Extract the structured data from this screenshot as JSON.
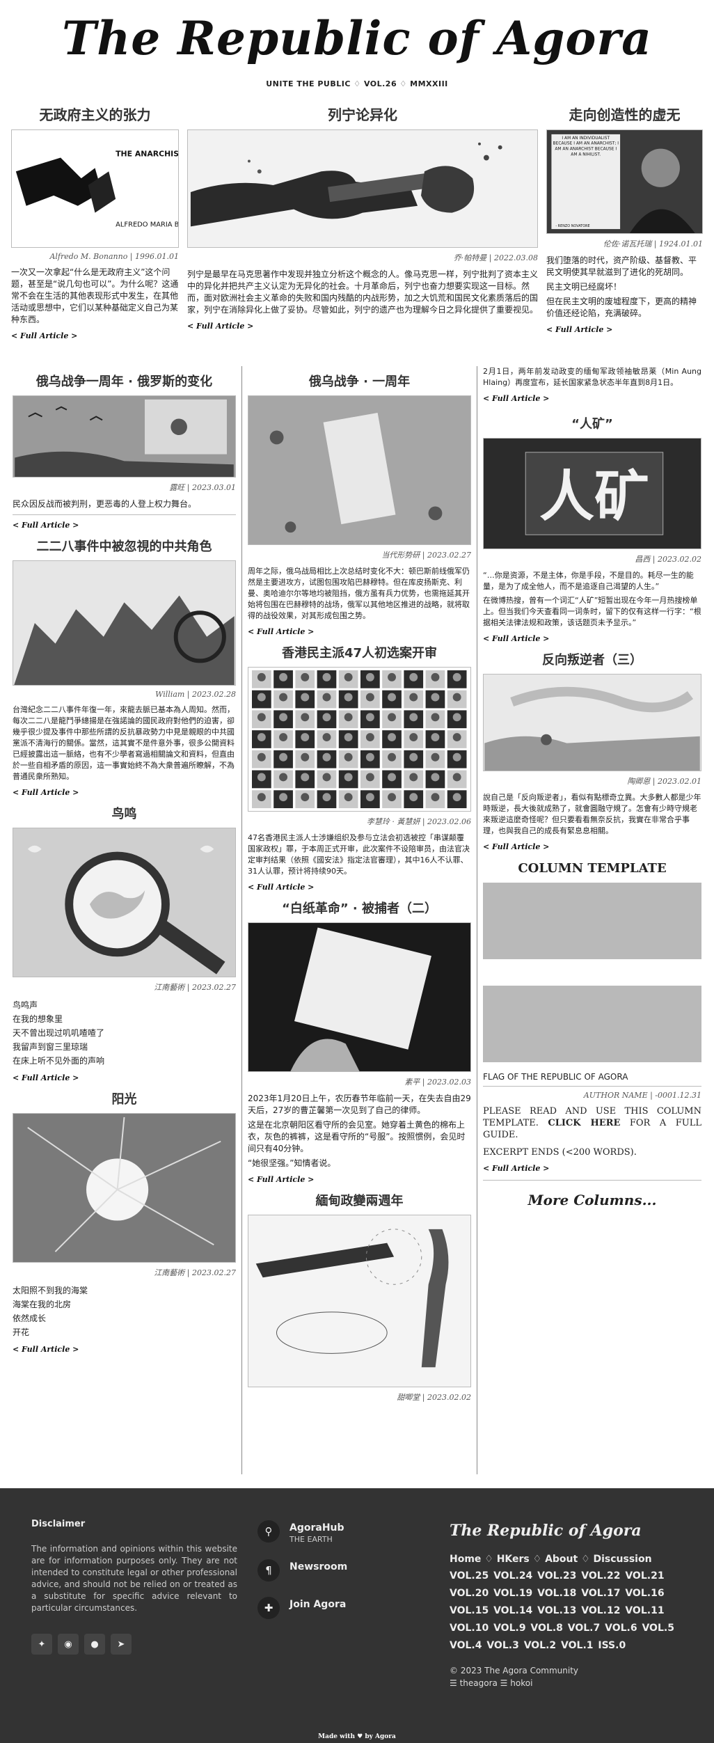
{
  "masthead": {
    "title": "The Republic of Agora",
    "subtitle": "UNITE THE PUBLIC ♢ VOL.26 ♢ MMXXIII"
  },
  "common": {
    "full_article": "< Full Article >"
  },
  "top": [
    {
      "title": "无政府主义的张力",
      "byline": "Alfredo M. Bonanno | 1996.01.01",
      "paragraphs": [
        "一次又一次拿起“什么是无政府主义”这个问题，甚至是“说几句也可以”。为什么呢？这通常不会在生活的其他表现形式中发生，在其他活动或思想中，它们以某种基础定义自己为某种东西。"
      ],
      "image_text": [
        "THE ANARCHIST TENSION",
        "ALFREDO MARIA BONANNO"
      ]
    },
    {
      "title": "列宁论异化",
      "byline": "乔·帕特曼 | 2022.03.08",
      "paragraphs": [
        "列宁是最早在马克思著作中发现并独立分析这个概念的人。像马克思一样，列宁批判了资本主义中的异化并把共产主义认定为无异化的社会。十月革命后，列宁也奋力想要实现这一目标。然而，面对欧洲社会主义革命的失败和国内残酷的内战形势，加之大饥荒和国民文化素质落后的国家，列宁在消除异化上做了妥协。尽管如此，列宁的遗产也为理解今日之异化提供了重要视见。"
      ]
    },
    {
      "title": "走向创造性的虚无",
      "byline": "伦佐·诺瓦托瑞 | 1924.01.01",
      "paragraphs": [
        "我们堕落的时代，资产阶级、基督教、平民文明使其早就滋到了进化的死胡同。",
        "民主文明已经腐坏！",
        "但在民主文明的废墟程度下，更高的精神价值还经论陷，充满破碎。"
      ],
      "image_text": [
        "I AM AN INDIVIDUALIST BECAUSE I AM AN ANARCHIST; I AM AN ANARCHIST BECAUSE I AM A NIHILIST.",
        "- RENZO NOVATORE"
      ]
    }
  ],
  "col1": [
    {
      "title": "俄乌战争一周年 · 俄罗斯的变化",
      "byline": "露旺 | 2023.03.01",
      "paragraphs": [
        "民众因反战而被判刑，更恶毒的人登上权力舞台。"
      ]
    },
    {
      "title": "二二八事件中被忽視的中共角色",
      "byline": "William | 2023.02.28",
      "paragraphs": [
        "台灣紀念二二八事件年復一年，來龍去脈已基本為人周知。然而，每次二二八是龍鬥爭總揚是在強諾論的國民政府對他們的迫害，卻幾乎很少提及事件中那些所謂的反抗暴政勢力中見是親眼的中共國黨派不清海行的關係。當然，這其實不是件意外事，很多公開資料已經披露出這一脈絡，也有不少學者寫過相關論文和資料，但直由於一些自相矛盾的原因，這一事實始終不為大衆普遍所瞭解，不為普通民衆所熟知。"
      ]
    },
    {
      "title": "鸟鸣",
      "byline": "江南藝術 | 2023.02.27",
      "lines": [
        "鸟鸣声",
        "在我的想象里",
        "天不曾出现过叽叽喳喳了",
        "我留声到窗三里琼瑞",
        "在床上听不见外面的声响"
      ]
    },
    {
      "title": "阳光",
      "byline": "江南藝術 | 2023.02.27",
      "lines": [
        "太阳照不到我的海棠",
        "海棠在我的北房",
        "依然成长",
        "开花"
      ]
    }
  ],
  "col2": [
    {
      "title": "俄乌战争 · 一周年",
      "byline": "当代形势研 | 2023.02.27",
      "paragraphs": [
        "周年之际，俄乌战局相比上次总结时变化不大：顿巴斯前线俄军仍然是主要进攻方，试图包围攻陷巴赫穆特。但在库皮扬斯克、利曼、奥哈迪尔尔等地均被阻挡，俄方虽有兵力优势，也需拖延其开始将包围在巴赫穆特的战场，俄军以其他地区推进的战略，就将取得的战役效果，对其形成包围之势。"
      ]
    },
    {
      "title": "香港民主派47人初选案开审",
      "byline": "李慧玲 · 黃慧妍 | 2023.02.06",
      "paragraphs": [
        "47名香港民主派人士涉嫌组织及参与立法会初选被控「串谋颠覆国家政权」罪，于本周正式开审，此次案件不设陪审员，由法官决定审判结果（依照《國安法》指定法官審理），其中16人不认罪、31人认罪，预计将持续90天。"
      ]
    },
    {
      "title": "“白纸革命” · 被捕者（二）",
      "byline": "素平 | 2023.02.03",
      "paragraphs": [
        "2023年1月20日上午，农历春节年临前一天，在失去自由29天后，27岁的曹芷馨第一次见到了自己的律师。",
        "这是在北京朝阳区看守所的会见室。她穿着土黄色的棉布上衣，灰色的裤裤，这是看守所的“号服”。按照惯例，会见时间只有40分钟。",
        "“她很坚强。”知情者说。"
      ]
    },
    {
      "title": "緬甸政變兩週年",
      "byline": "甜唧堂 | 2023.02.02"
    }
  ],
  "col3": [
    {
      "paragraphs": [
        "2月1日，两年前发动政变的缅甸军政领袖敏昂莱（Min Aung Hlaing）再度宣布，延长国家紧急状态半年直到8月1日。"
      ]
    },
    {
      "title": "“人矿”",
      "byline": "昌西 | 2023.02.02",
      "image_text": "人矿",
      "paragraphs": [
        "“…你是资源，不是主体，你是手段，不是目的。耗尽一生的能量，是为了成全他人，而不是追逐自己渴望的人生。”",
        "在微博热搜，曾有一个词汇“人矿”短暂出现在今年一月热搜榜单上。但当我们今天查看同一词条时，留下的仅有这样一行字：“根据相关法律法规和政策，该话题页未予显示。”"
      ]
    },
    {
      "title": "反向叛逆者（三）",
      "byline": "陶卿恩 | 2023.02.01",
      "paragraphs": [
        "說自己是「反向叛逆者」，看似有點標奇立異。大多數人都是少年時叛逆，長大後就成熟了，就會圓融守規了。怎會有少時守規老來叛逆這麼奇怪呢？但只要看看無奈反抗，我實在非常合乎事理，也與我自己的成長有緊息息相關。"
      ]
    },
    {
      "title": "COLUMN TEMPLATE",
      "caption": "FLAG OF THE REPUBLIC OF AGORA",
      "byline": "AUTHOR NAME | -0001.12.31",
      "template_text": "PLEASE READ AND USE THIS COLUMN TEMPLATE.",
      "click_here": "CLICK HERE",
      "template_after": "FOR A FULL GUIDE.",
      "excerpt_note": "EXCERPT ENDS (<200 WORDS)."
    },
    {
      "more_columns": "More Columns..."
    }
  ],
  "footer": {
    "disclaimer_title": "Disclaimer",
    "disclaimer_text": "The information and opinions within this website are for information purposes only. They are not intended to constitute legal or other professional advice, and should not be relied on or treated as a substitute for specific advice relevant to particular circumstances.",
    "social_icons": [
      "twitter-icon",
      "github-icon",
      "reddit-icon",
      "telegram-icon"
    ],
    "links": [
      {
        "label": "AgoraHub",
        "sub": "THE EARTH",
        "icon": "map-pin-icon"
      },
      {
        "label": "Newsroom",
        "sub": "",
        "icon": "paragraph-icon"
      },
      {
        "label": "Join Agora",
        "sub": "",
        "icon": "puzzle-icon"
      }
    ],
    "brand": "The Republic of Agora",
    "nav": "Home ♢ HKers ♢ About ♢ Discussion",
    "volumes": "VOL.25 VOL.24 VOL.23 VOL.22 VOL.21 VOL.20 VOL.19 VOL.18 VOL.17 VOL.16 VOL.15 VOL.14 VOL.13 VOL.12 VOL.11 VOL.10 VOL.9 VOL.8 VOL.7 VOL.6 VOL.5 VOL.4 VOL.3 VOL.2 VOL.1 ISS.0",
    "copyright": "© 2023 The Agora Community",
    "handles": "☰ theagora ☰ hokoi",
    "made_with": "Made with ♥ by Agora"
  }
}
